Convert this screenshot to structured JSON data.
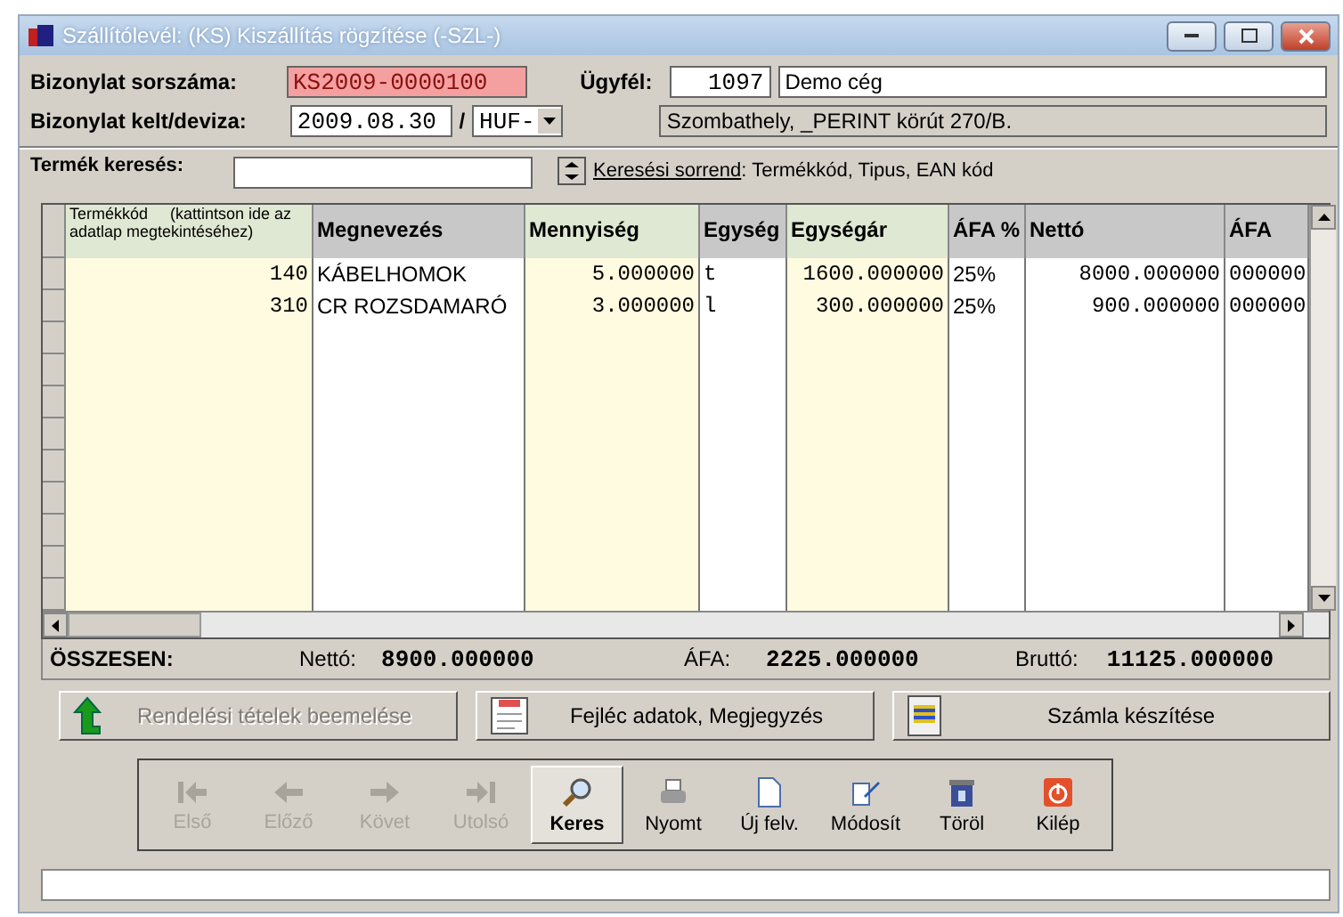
{
  "window": {
    "title": "Szállítólevél: (KS) Kiszállítás rögzítése (-SZL-)"
  },
  "header": {
    "doc_number_label": "Bizonylat sorszáma:",
    "doc_number": "KS2009-0000100",
    "customer_label": "Ügyfél:",
    "customer_code": "1097",
    "customer_name": "Demo cég",
    "date_label": "Bizonylat kelt/deviza:",
    "date": "2009.08.30",
    "separator": "/",
    "currency": "HUF-",
    "address": "Szombathely, _PERINT körút 270/B."
  },
  "search": {
    "label": "Termék keresés:",
    "sort_link": "Keresési sorrend",
    "sort_text": ": Termékkód, Tipus, EAN kód"
  },
  "table": {
    "columns": [
      {
        "label": "Termékkód     (kattintson ide az adatlap megtekintéséhez)",
        "editable": true
      },
      {
        "label": "Megnevezés",
        "editable": false
      },
      {
        "label": "Mennyiség",
        "editable": true
      },
      {
        "label": "Egység",
        "editable": false
      },
      {
        "label": "Egységár",
        "editable": true
      },
      {
        "label": "ÁFA %",
        "editable": false
      },
      {
        "label": "Nettó",
        "editable": false
      },
      {
        "label": "ÁFA",
        "editable": false
      }
    ],
    "rows": [
      [
        "140",
        "KÁBELHOMOK",
        "5.000000",
        "t",
        "1600.000000",
        "25%",
        "8000.000000",
        "000000"
      ],
      [
        "310",
        "CR ROZSDAMARÓ",
        "3.000000",
        "l",
        "300.000000",
        "25%",
        "900.000000",
        "000000"
      ]
    ]
  },
  "totals": {
    "label": "ÖSSZESEN:",
    "net_label": "Nettó:",
    "net": "8900.000000",
    "vat_label": "ÁFA:",
    "vat": "2225.000000",
    "gross_label": "Bruttó:",
    "gross": "11125.000000"
  },
  "actions": [
    {
      "kind": "import",
      "label": "Rendelési tételek beemelése",
      "disabled": true
    },
    {
      "kind": "notes",
      "label": "Fejléc adatok, Megjegyzés",
      "disabled": false
    },
    {
      "kind": "invoice",
      "label": "Számla készítése",
      "disabled": false
    }
  ],
  "toolbar": [
    {
      "kind": "first",
      "label": "Első",
      "disabled": true,
      "selected": false
    },
    {
      "kind": "prev",
      "label": "Előző",
      "disabled": true,
      "selected": false
    },
    {
      "kind": "next",
      "label": "Követ",
      "disabled": true,
      "selected": false
    },
    {
      "kind": "last",
      "label": "Utolsó",
      "disabled": true,
      "selected": false
    },
    {
      "kind": "search",
      "label": "Keres",
      "disabled": false,
      "selected": true
    },
    {
      "kind": "print",
      "label": "Nyomt",
      "disabled": false,
      "selected": false
    },
    {
      "kind": "new",
      "label": "Új felv.",
      "disabled": false,
      "selected": false
    },
    {
      "kind": "edit",
      "label": "Módosít",
      "disabled": false,
      "selected": false
    },
    {
      "kind": "delete",
      "label": "Töröl",
      "disabled": false,
      "selected": false
    },
    {
      "kind": "exit",
      "label": "Kilép",
      "disabled": false,
      "selected": false
    }
  ]
}
